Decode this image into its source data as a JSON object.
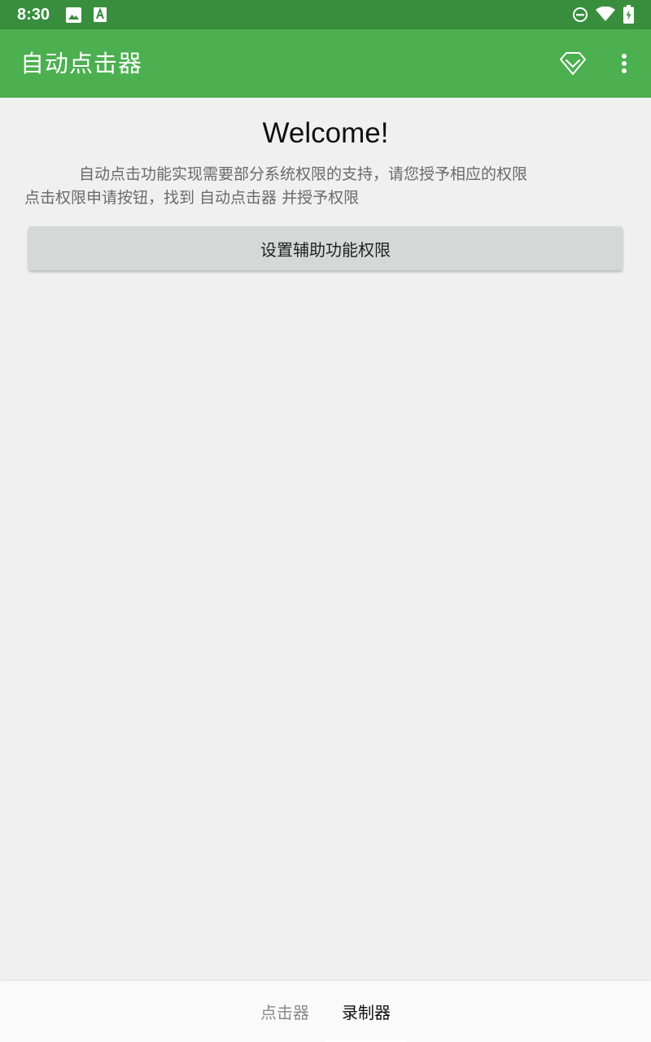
{
  "status_bar": {
    "time": "8:30",
    "icons": [
      "image-icon",
      "font-a-icon",
      "do-not-disturb-icon",
      "wifi-icon",
      "battery-charging-icon"
    ]
  },
  "app_bar": {
    "title": "自动点击器",
    "actions": [
      "diamond-icon",
      "more-vert-icon"
    ],
    "color": "#4caf50",
    "status_color": "#388e3c"
  },
  "content": {
    "welcome": "Welcome!",
    "description_line1": "自动点击功能实现需要部分系统权限的支持，请您授予相应的权限",
    "description_line2": "点击权限申请按钮，找到 自动点击器 并授予权限",
    "button_label": "设置辅助功能权限"
  },
  "bottom_tabs": {
    "items": [
      {
        "label": "点击器",
        "selected": false
      },
      {
        "label": "录制器",
        "selected": true
      }
    ]
  }
}
